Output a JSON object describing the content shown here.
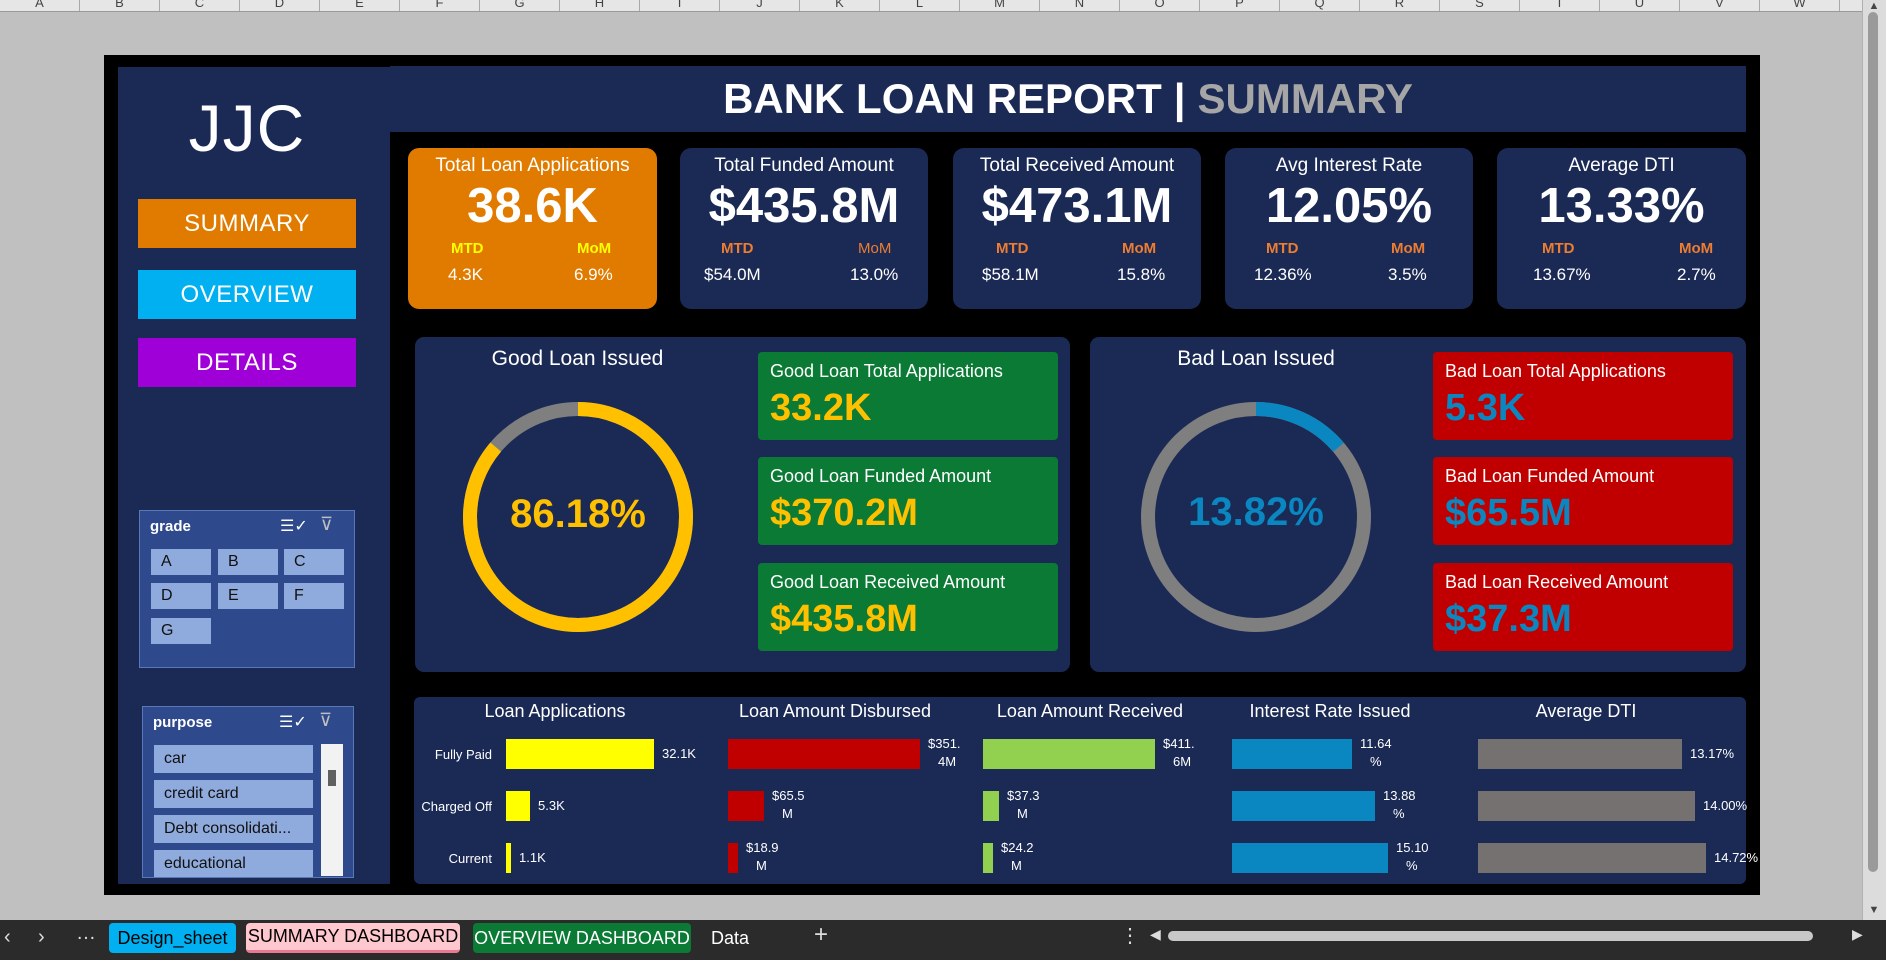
{
  "columns": [
    "A",
    "B",
    "C",
    "D",
    "E",
    "F",
    "G",
    "H",
    "I",
    "J",
    "K",
    "L",
    "M",
    "N",
    "O",
    "P",
    "Q",
    "R",
    "S",
    "T",
    "U",
    "V",
    "W"
  ],
  "logo": "JJC",
  "nav": {
    "summary": "SUMMARY",
    "overview": "OVERVIEW",
    "details": "DETAILS"
  },
  "title": {
    "main": "BANK LOAN REPORT",
    "sep": "|",
    "sub": "SUMMARY"
  },
  "kpis": [
    {
      "title": "Total Loan Applications",
      "value": "38.6K",
      "mtd_label": "MTD",
      "mom_label": "MoM",
      "mtd": "4.3K",
      "mom": "6.9%"
    },
    {
      "title": "Total Funded Amount",
      "value": "$435.8M",
      "mtd_label": "MTD",
      "mom_label": "MoM",
      "mtd": "$54.0M",
      "mom": "13.0%"
    },
    {
      "title": "Total Received Amount",
      "value": "$473.1M",
      "mtd_label": "MTD",
      "mom_label": "MoM",
      "mtd": "$58.1M",
      "mom": "15.8%"
    },
    {
      "title": "Avg Interest Rate",
      "value": "12.05%",
      "mtd_label": "MTD",
      "mom_label": "MoM",
      "mtd": "12.36%",
      "mom": "3.5%"
    },
    {
      "title": "Average DTI",
      "value": "13.33%",
      "mtd_label": "MTD",
      "mom_label": "MoM",
      "mtd": "13.67%",
      "mom": "2.7%"
    }
  ],
  "good": {
    "title": "Good Loan Issued",
    "pct_label": "86.18%",
    "pct": 86.18,
    "cards": [
      {
        "title": "Good Loan Total Applications",
        "value": "33.2K"
      },
      {
        "title": "Good Loan Funded Amount",
        "value": "$370.2M"
      },
      {
        "title": "Good Loan Received Amount",
        "value": "$435.8M"
      }
    ]
  },
  "bad": {
    "title": "Bad Loan Issued",
    "pct_label": "13.82%",
    "pct": 13.82,
    "cards": [
      {
        "title": "Bad Loan Total Applications",
        "value": "5.3K"
      },
      {
        "title": "Bad Loan Funded Amount",
        "value": "$65.5M"
      },
      {
        "title": "Bad Loan Received Amount",
        "value": "$37.3M"
      }
    ]
  },
  "slicers": {
    "grade": {
      "title": "grade",
      "items": [
        "A",
        "B",
        "C",
        "D",
        "E",
        "F",
        "G"
      ]
    },
    "purpose": {
      "title": "purpose",
      "items": [
        "car",
        "credit card",
        "Debt consolidati...",
        "educational"
      ]
    }
  },
  "chart_data": {
    "type": "bar",
    "categories": [
      "Fully Paid",
      "Charged Off",
      "Current"
    ],
    "panels": [
      {
        "title": "Loan Applications",
        "values": [
          32.1,
          5.3,
          1.1
        ],
        "labels": [
          [
            "32.1K"
          ],
          [
            "5.3K"
          ],
          [
            "1.1K"
          ]
        ],
        "color": "#ffff00"
      },
      {
        "title": "Loan Amount Disbursed",
        "values": [
          351.4,
          65.5,
          18.9
        ],
        "labels": [
          [
            "$351.",
            "4M"
          ],
          [
            "$65.5",
            "M"
          ],
          [
            "$18.9",
            "M"
          ]
        ],
        "color": "#c00000"
      },
      {
        "title": "Loan Amount Received",
        "values": [
          411.6,
          37.3,
          24.2
        ],
        "labels": [
          [
            "$411.",
            "6M"
          ],
          [
            "$37.3",
            "M"
          ],
          [
            "$24.2",
            "M"
          ]
        ],
        "color": "#92d050"
      },
      {
        "title": "Interest Rate Issued",
        "values": [
          11.64,
          13.88,
          15.1
        ],
        "labels": [
          [
            "11.64",
            "%"
          ],
          [
            "13.88",
            "%"
          ],
          [
            "15.10",
            "%"
          ]
        ],
        "color": "#0a87c0"
      },
      {
        "title": "Average DTI",
        "values": [
          13.17,
          14.0,
          14.72
        ],
        "labels": [
          [
            "13.17%"
          ],
          [
            "14.00%"
          ],
          [
            "14.72%"
          ]
        ],
        "color": "#767171"
      }
    ]
  },
  "tabs": [
    "Design_sheet",
    "SUMMARY DASHBOARD",
    "OVERVIEW DASHBOARD",
    "Data"
  ],
  "colors": {
    "orange": "#e07b00",
    "cyan": "#00b0f0",
    "purple": "#a000d8",
    "navy": "#1b2a55",
    "good": "#0a7a35",
    "bad": "#c00000",
    "good_ring": "#ffc000",
    "bad_ring": "#0a87c0",
    "ring_bg": "#7f7f7f"
  }
}
